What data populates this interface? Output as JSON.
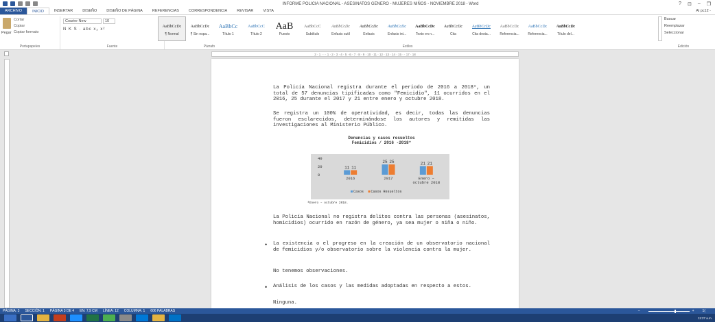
{
  "window": {
    "title": "INFORME POLICIA NACIONAL - ASESINATOS GENERO - MUJERES NIÑOS - NOVIEMBRE 2018 - Word",
    "controls": [
      "?",
      "⊡",
      "–",
      "❐"
    ],
    "user": "Al pc12 -"
  },
  "tabs": [
    "ARCHIVO",
    "INICIO",
    "INSERTAR",
    "DISEÑO",
    "DISEÑO DE PÁGINA",
    "REFERENCIAS",
    "CORRESPONDENCIA",
    "REVISAR",
    "VISTA"
  ],
  "ribbon": {
    "clipboard": {
      "paste": "Pegar",
      "cut": "Cortar",
      "copy": "Copiar",
      "format_painter": "Copiar formato",
      "group": "Portapapeles"
    },
    "font": {
      "family": "Courier New",
      "size": "10",
      "format_row": "N  K  S  ·  abc  x₂  x²",
      "group": "Fuente"
    },
    "paragraph": {
      "group": "Párrafo"
    },
    "styles": {
      "group": "Estilos",
      "items": [
        {
          "sample": "AaBbCcDc",
          "name": "¶ Normal"
        },
        {
          "sample": "AaBbCcDc",
          "name": "¶ Sin espa..."
        },
        {
          "sample": "AaBbCc",
          "name": "Título 1"
        },
        {
          "sample": "AaBbCcC",
          "name": "Título 2"
        },
        {
          "sample": "AaB",
          "name": "Puesto"
        },
        {
          "sample": "AaBbCcC",
          "name": "Subtítulo"
        },
        {
          "sample": "AaBbCcDc",
          "name": "Énfasis sutil"
        },
        {
          "sample": "AaBbCcDc",
          "name": "Énfasis"
        },
        {
          "sample": "AaBbCcDc",
          "name": "Énfasis int..."
        },
        {
          "sample": "AaBbCcDc",
          "name": "Texto en n..."
        },
        {
          "sample": "AaBbCcDc",
          "name": "Cita"
        },
        {
          "sample": "AaBbCcDc",
          "name": "Cita desta..."
        },
        {
          "sample": "AaBbCcDc",
          "name": "Referencia..."
        },
        {
          "sample": "AaBbCcDc",
          "name": "Referencia..."
        },
        {
          "sample": "AaBbCcDc",
          "name": "Título del..."
        }
      ]
    },
    "editing": {
      "find": "Buscar",
      "replace": "Reemplazar",
      "select": "Seleccionar",
      "group": "Edición"
    }
  },
  "ruler": {
    "text": "2 · 1 · · · 1 · 2 · 3 · 4 · 5 · 6 · 7 · 8 · 9 · 10 · 11 · 12 · 13 · 14 · 15 · · 17 · 18"
  },
  "document": {
    "p1": "La Policía Nacional registra durante el periodo de 2016 a 2018⁸, un total de 57 denuncias tipificadas como \"Femicidio\", 11 ocurridos en el 2016, 25 durante el 2017 y 21 entre enero y octubre 2018.",
    "p2": "Se registra un 100% de operatividad, es decir, todas las denuncias fueron esclarecidos, determinándose los autores y remitidas las investigaciones al Ministerio Público.",
    "p3": "La Policía Nacional no registra delitos contra las personas (asesinatos, homicidios) ocurrido en razón de género, ya sea mujer o niña o niño.",
    "bullet1": "La existencia o el progreso en la creación de un observatorio nacional de femicidios y/o observatorio sobre la violencia contra la mujer.",
    "p4": "No tenemos observaciones.",
    "bullet2": "Análisis de los casos y las medidas adoptadas en respecto a estos.",
    "p5": "Ninguna.",
    "bullet_glyph": "•",
    "footnote": "⁸Enero – octubre 2018."
  },
  "chart_data": {
    "type": "bar",
    "title": "Denuncias y casos resueltos",
    "subtitle": "Femicidios / 2016 -2018*",
    "categories": [
      "2016",
      "2017",
      "Enero – octubre 2018"
    ],
    "series": [
      {
        "name": "Casos",
        "values": [
          11,
          25,
          21
        ],
        "color": "#5b9bd5"
      },
      {
        "name": "Casos Resueltos",
        "values": [
          11,
          25,
          21
        ],
        "color": "#ed7d31"
      }
    ],
    "ylim": [
      0,
      40
    ],
    "yticks": [
      0,
      20,
      40
    ],
    "legend": "bottom"
  },
  "status": {
    "items": [
      "PÁGINA: 3",
      "SECCIÓN: 1",
      "PÁGINA 3 DE 4",
      "EN: 7,9 CM",
      "LÍNEA: 12",
      "COLUMNA: 1",
      "606 PALABRAS"
    ],
    "zoom_minus": "–",
    "zoom_plus": "+",
    "zoom": "1("
  },
  "taskbar": {
    "clock": "11:27 a.m."
  }
}
